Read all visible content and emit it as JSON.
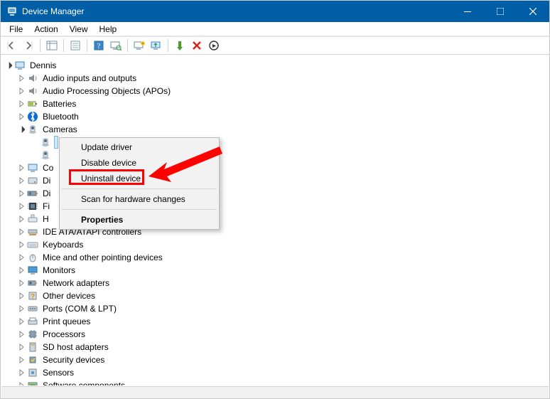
{
  "window": {
    "title": "Device Manager"
  },
  "menubar": {
    "items": [
      "File",
      "Action",
      "View",
      "Help"
    ]
  },
  "tree": {
    "root": "Dennis",
    "categories": [
      "Audio inputs and outputs",
      "Audio Processing Objects (APOs)",
      "Batteries",
      "Bluetooth",
      "Cameras",
      "Computer",
      "Disk drives",
      "Display adapters",
      "Firmware",
      "Human Interface Devices",
      "IDE ATA/ATAPI controllers",
      "Keyboards",
      "Mice and other pointing devices",
      "Monitors",
      "Network adapters",
      "Other devices",
      "Ports (COM & LPT)",
      "Print queues",
      "Processors",
      "SD host adapters",
      "Security devices",
      "Sensors",
      "Software components"
    ],
    "truncations": {
      "Computer": "Co",
      "Disk drives": "Di",
      "Display adapters": "Di",
      "Firmware": "Fi",
      "Human Interface Devices": "H"
    }
  },
  "context_menu": {
    "items": [
      {
        "label": "Update driver"
      },
      {
        "label": "Disable device"
      },
      {
        "label": "Uninstall device"
      },
      {
        "sep": true
      },
      {
        "label": "Scan for hardware changes"
      },
      {
        "sep": true
      },
      {
        "label": "Properties",
        "bold": true
      }
    ]
  }
}
